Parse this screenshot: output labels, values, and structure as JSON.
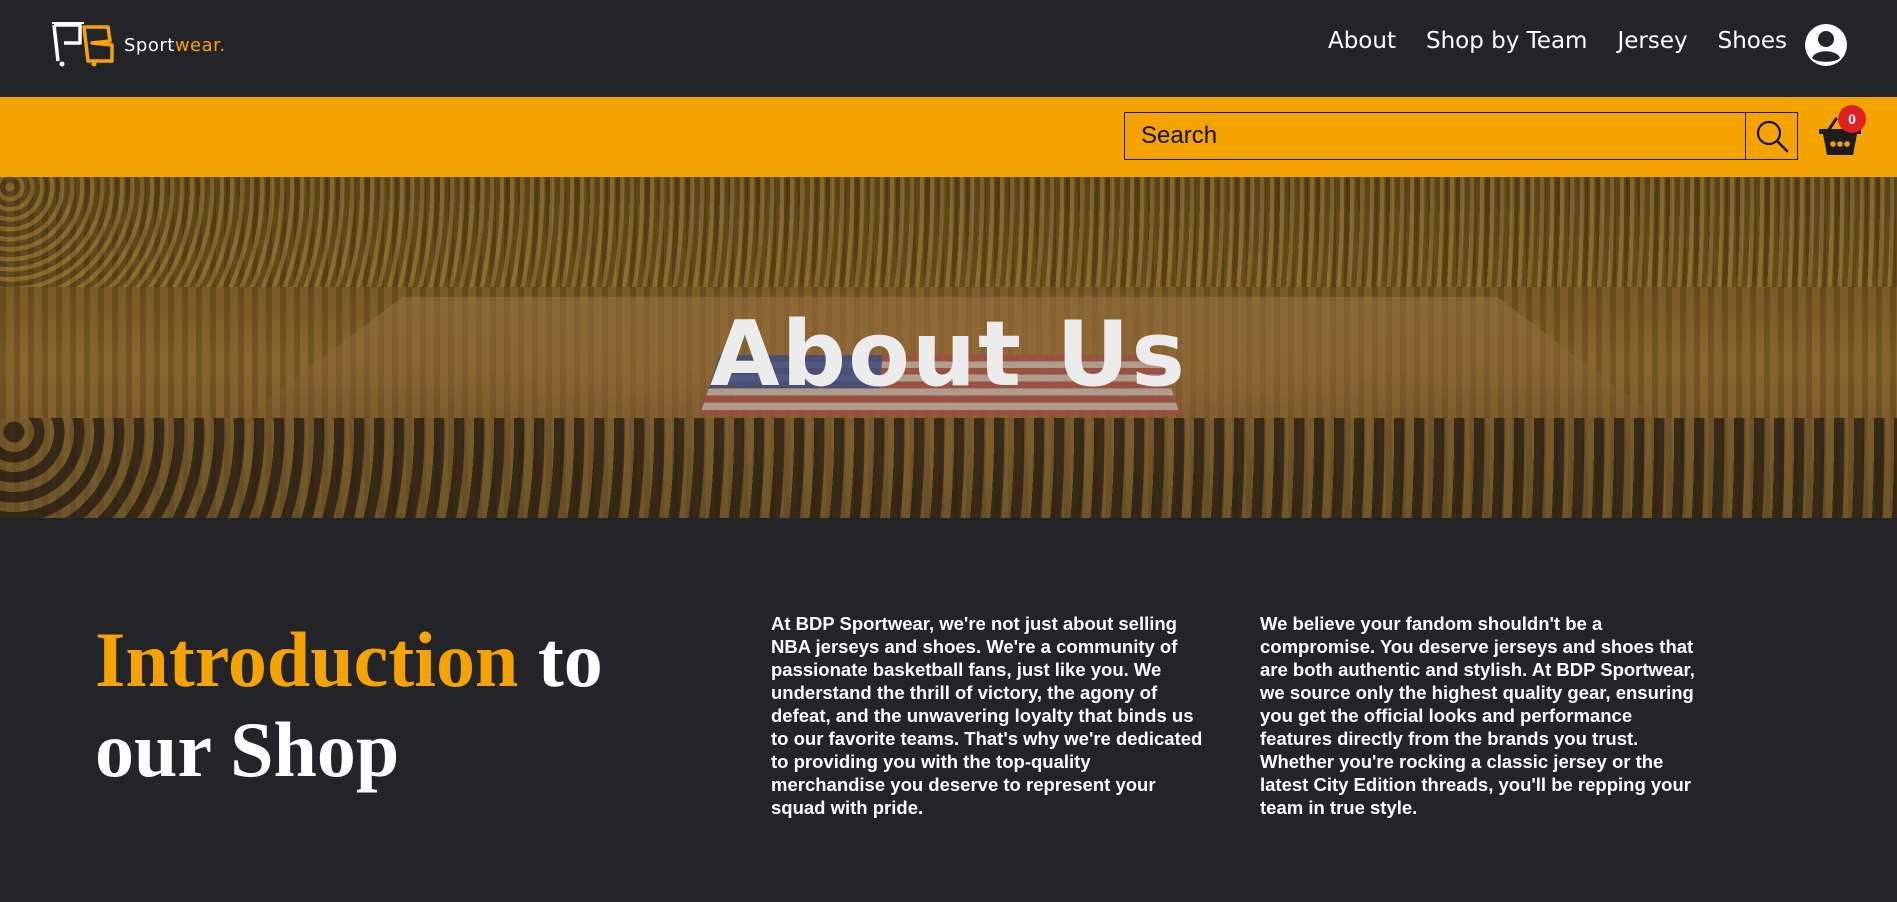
{
  "brand": {
    "logo_letters": "PB",
    "name_white": "Sport",
    "name_orange": "wear."
  },
  "nav": {
    "items": [
      "About",
      "Shop by Team",
      "Jersey",
      "Shoes"
    ]
  },
  "icons": {
    "account": "account-circle-icon",
    "search": "search-icon",
    "cart": "basket-icon"
  },
  "search": {
    "placeholder": "Search",
    "value": ""
  },
  "cart": {
    "count": "0"
  },
  "hero": {
    "title": "About Us"
  },
  "intro": {
    "heading_highlight": "Introduction",
    "heading_rest": " to our Shop",
    "paragraph_1": "At BDP Sportwear, we're not just about selling NBA jerseys and shoes. We're a community of passionate basketball fans, just like you. We understand the thrill of victory, the agony of defeat, and the unwavering loyalty that binds us to our favorite teams. That's why we're dedicated to providing you with the top-quality merchandise you deserve to represent your squad with pride.",
    "paragraph_2": "We believe your fandom shouldn't be a compromise. You deserve jerseys and shoes that are both authentic and stylish. At BDP Sportwear, we source only the highest quality gear, ensuring you get the official looks and performance features directly from the brands you trust. Whether you're rocking a classic jersey or the latest City Edition threads, you'll be repping your team in true style."
  },
  "colors": {
    "accent": "#f5a300",
    "background": "#232427",
    "badge": "#e02020"
  }
}
